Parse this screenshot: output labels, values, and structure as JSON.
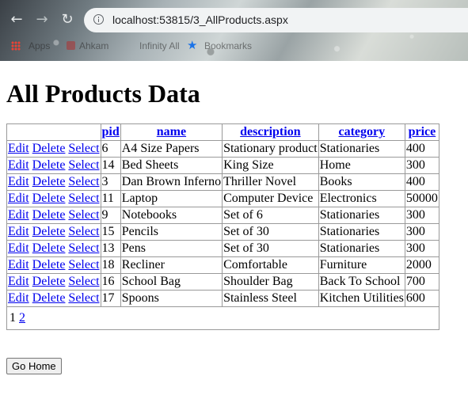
{
  "browser": {
    "url_host": "localhost",
    "url_rest": ":53815/3_AllProducts.aspx",
    "bookmarks": {
      "apps": "Apps",
      "item1": "Ahkam",
      "item2": "Infinity All",
      "bookmarks": "Bookmarks"
    }
  },
  "page": {
    "title": "All Products Data",
    "go_home_label": "Go Home"
  },
  "grid": {
    "headers": [
      "pid",
      "name",
      "description",
      "category",
      "price"
    ],
    "action_labels": {
      "edit": "Edit",
      "delete": "Delete",
      "select": "Select"
    },
    "rows": [
      {
        "pid": "6",
        "name": "A4 Size Papers",
        "description": "Stationary product",
        "category": "Stationaries",
        "price": "400"
      },
      {
        "pid": "14",
        "name": "Bed Sheets",
        "description": "King Size",
        "category": "Home",
        "price": "300"
      },
      {
        "pid": "3",
        "name": "Dan Brown Inferno",
        "description": "Thriller Novel",
        "category": "Books",
        "price": "400"
      },
      {
        "pid": "11",
        "name": "Laptop",
        "description": "Computer Device",
        "category": "Electronics",
        "price": "50000"
      },
      {
        "pid": "9",
        "name": "Notebooks",
        "description": "Set of 6",
        "category": "Stationaries",
        "price": "300"
      },
      {
        "pid": "15",
        "name": "Pencils",
        "description": "Set of 30",
        "category": "Stationaries",
        "price": "300"
      },
      {
        "pid": "13",
        "name": "Pens",
        "description": "Set of 30",
        "category": "Stationaries",
        "price": "300"
      },
      {
        "pid": "18",
        "name": "Recliner",
        "description": "Comfortable",
        "category": "Furniture",
        "price": "2000"
      },
      {
        "pid": "16",
        "name": "School Bag",
        "description": "Shoulder Bag",
        "category": "Back To School",
        "price": "700"
      },
      {
        "pid": "17",
        "name": "Spoons",
        "description": "Stainless Steel",
        "category": "Kitchen Utilities",
        "price": "600"
      }
    ],
    "pager": {
      "current": "1",
      "next": "2"
    }
  }
}
